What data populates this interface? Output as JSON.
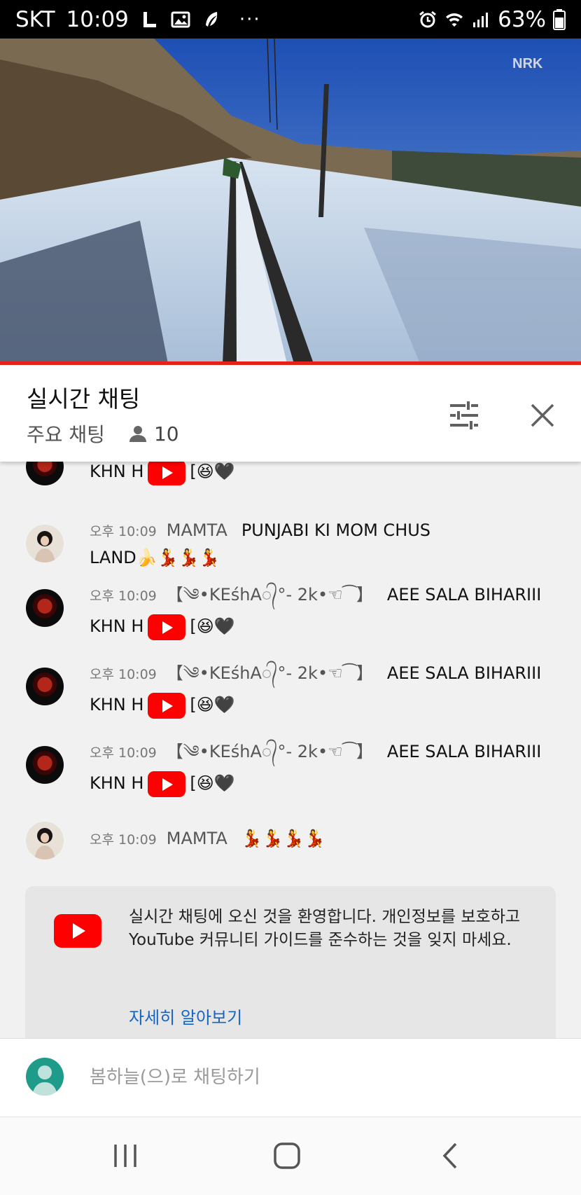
{
  "status_bar": {
    "carrier": "SKT",
    "time": "10:09",
    "battery": "63%",
    "icons": [
      "line-icon",
      "gallery-icon",
      "feather-icon",
      "more-dots-icon",
      "alarm-icon",
      "wifi-icon",
      "signal-icon",
      "battery-icon"
    ]
  },
  "video": {
    "watermark": "NRK",
    "progress_color": "#e62117"
  },
  "chat_header": {
    "title": "실시간 채팅",
    "mode": "주요 채팅",
    "viewer_count": "10",
    "icons": [
      "filter-sliders-icon",
      "close-icon"
    ]
  },
  "messages": [
    {
      "time": "",
      "author": "",
      "text_before": "KHN H",
      "text_after": "[😆🖤",
      "avatar": "dark"
    },
    {
      "time": "오후 10:09",
      "author": "MAMTA",
      "text_line1": "PUNJABI KI MOM CHUS",
      "text_line2": "LAND🍌💃💃💃",
      "avatar": "girl"
    },
    {
      "time": "오후 10:09",
      "author": "【༄•KEśhA᭄°- 2k•☜⁀】",
      "text_line1": "AEE SALA BIHARIII",
      "text_before": "KHN H",
      "text_after": "[😆🖤",
      "avatar": "dark"
    },
    {
      "time": "오후 10:09",
      "author": "【༄•KEśhA᭄°- 2k•☜⁀】",
      "text_line1": "AEE SALA BIHARIII",
      "text_before": "KHN H",
      "text_after": "[😆🖤",
      "avatar": "dark"
    },
    {
      "time": "오후 10:09",
      "author": "【༄•KEśhA᭄°- 2k•☜⁀】",
      "text_line1": "AEE SALA BIHARIII",
      "text_before": "KHN H",
      "text_after": "[😆🖤",
      "avatar": "dark"
    },
    {
      "time": "오후 10:09",
      "author": "MAMTA",
      "text_line1": "💃💃💃💃",
      "avatar": "girl"
    }
  ],
  "welcome": {
    "message": "실시간 채팅에 오신 것을 환영합니다. 개인정보를 보호하고 YouTube 커뮤니티 가이드를 준수하는 것을 잊지 마세요.",
    "learn_more": "자세히 알아보기"
  },
  "input": {
    "placeholder": "봄하늘(으)로 채팅하기"
  },
  "nav_bar": {
    "icons": [
      "recents-icon",
      "home-icon",
      "back-icon"
    ]
  }
}
